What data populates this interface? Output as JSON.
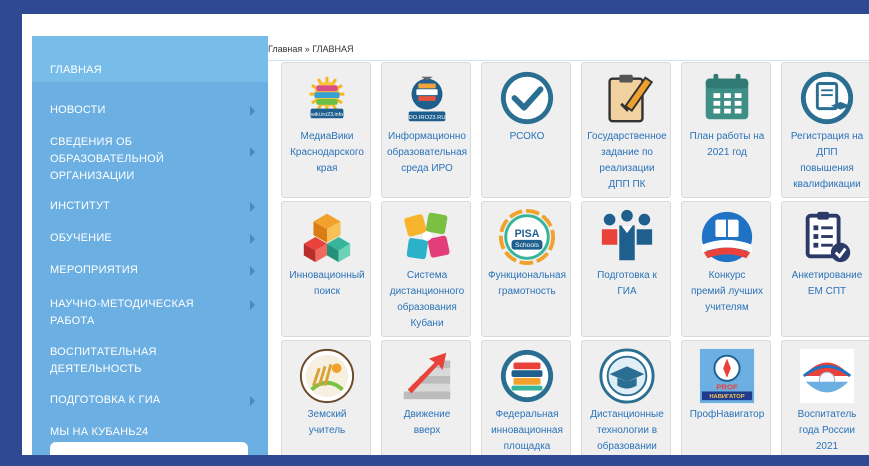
{
  "sidebar": {
    "items": [
      {
        "label": "ГЛАВНАЯ",
        "lines": [
          "ГЛАВНАЯ"
        ],
        "has_arrow": false
      },
      {
        "label": "НОВОСТИ",
        "lines": [
          "НОВОСТИ"
        ],
        "has_arrow": true
      },
      {
        "label": "СВЕДЕНИЯ ОБ ОБРАЗОВАТЕЛЬНОЙ ОРГАНИЗАЦИИ",
        "lines": [
          "СВЕДЕНИЯ ОБ",
          "ОБРАЗОВАТЕЛЬНОЙ",
          "ОРГАНИЗАЦИИ"
        ],
        "has_arrow": true
      },
      {
        "label": "ИНСТИТУТ",
        "lines": [
          "ИНСТИТУТ"
        ],
        "has_arrow": true
      },
      {
        "label": "ОБУЧЕНИЕ",
        "lines": [
          "ОБУЧЕНИЕ"
        ],
        "has_arrow": true
      },
      {
        "label": "МЕРОПРИЯТИЯ",
        "lines": [
          "МЕРОПРИЯТИЯ"
        ],
        "has_arrow": true
      },
      {
        "label": "НАУЧНО-МЕТОДИЧЕСКАЯ РАБОТА",
        "lines": [
          "НАУЧНО-МЕТОДИЧЕСКАЯ",
          "РАБОТА"
        ],
        "has_arrow": true
      },
      {
        "label": "ВОСПИТАТЕЛЬНАЯ ДЕЯТЕЛЬНОСТЬ",
        "lines": [
          "ВОСПИТАТЕЛЬНАЯ",
          "ДЕЯТЕЛЬНОСТЬ"
        ],
        "has_arrow": false
      },
      {
        "label": "ПОДГОТОВКА К ГИА",
        "lines": [
          "ПОДГОТОВКА К ГИА"
        ],
        "has_arrow": true
      },
      {
        "label": "МЫ НА КУБАНЬ24",
        "lines": [
          "МЫ НА КУБАНЬ24"
        ],
        "has_arrow": false
      }
    ]
  },
  "breadcrumb": "Главная » ГЛАВНАЯ",
  "tiles": [
    {
      "name": "mediawiki",
      "lines": [
        "МедиаВики",
        "Краснодарского",
        "края"
      ],
      "icon": "wiki-books-icon",
      "logo_text": "wiki.iro23.info"
    },
    {
      "name": "info-env",
      "lines": [
        "Информационно",
        "образовательная",
        "среда ИРО"
      ],
      "icon": "iro-books-icon",
      "logo_text": "DO.IRO23.RU"
    },
    {
      "name": "rsoko",
      "lines": [
        "РСОКО"
      ],
      "icon": "checkmark-circle-icon"
    },
    {
      "name": "gos-zadanie",
      "lines": [
        "Государственное",
        "задание по",
        "реализации",
        "ДПП ПК"
      ],
      "icon": "clipboard-pencil-icon"
    },
    {
      "name": "plan-2021",
      "lines": [
        "План работы на",
        "2021 год"
      ],
      "icon": "calendar-icon"
    },
    {
      "name": "registration",
      "lines": [
        "Регистрация на",
        "ДПП",
        "повышения",
        "квалификации"
      ],
      "icon": "certificate-icon"
    },
    {
      "name": "innov-search",
      "lines": [
        "Инновационный",
        "поиск"
      ],
      "icon": "cubes-icon"
    },
    {
      "name": "distance-system",
      "lines": [
        "Система",
        "дистанционного",
        "образования",
        "Кубани"
      ],
      "icon": "puzzle-icon"
    },
    {
      "name": "func-literacy",
      "lines": [
        "Функциональная",
        "грамотность"
      ],
      "icon": "pisa-badge-icon",
      "logo_text": [
        "PISA",
        "Schools"
      ]
    },
    {
      "name": "gia-prep",
      "lines": [
        "Подготовка к",
        "ГИА"
      ],
      "icon": "students-icon"
    },
    {
      "name": "best-teachers",
      "lines": [
        "Конкурс",
        "премий лучших",
        "учителям"
      ],
      "icon": "book-flag-icon"
    },
    {
      "name": "survey",
      "lines": [
        "Анкетирование",
        "ЕМ СПТ"
      ],
      "icon": "checklist-icon"
    },
    {
      "name": "zemsky",
      "lines": [
        "Земский",
        "учитель"
      ],
      "icon": "zemsky-logo-icon"
    },
    {
      "name": "movement-up",
      "lines": [
        "Движение",
        "вверх"
      ],
      "icon": "stairs-arrow-icon"
    },
    {
      "name": "federal-innov",
      "lines": [
        "Федеральная",
        "инновационная",
        "площадка"
      ],
      "icon": "books-stack-icon"
    },
    {
      "name": "distance-tech",
      "lines": [
        "Дистанционные",
        "технологии в",
        "образовании"
      ],
      "icon": "grad-cap-icon"
    },
    {
      "name": "profnav",
      "lines": [
        "ПрофНавигатор"
      ],
      "icon": "compass-icon",
      "logo_text": [
        "PROF",
        "НАВИГАТОР"
      ]
    },
    {
      "name": "educator-year",
      "lines": [
        "Воспитатель",
        "года России",
        "2021"
      ],
      "icon": "shell-pearl-icon"
    }
  ],
  "colors": {
    "background": "#2f4a92",
    "sidebar": "#6cb0e3",
    "tile_bg": "#efefef",
    "link": "#2a73b8",
    "icon_blue": "#1f5f8e"
  }
}
